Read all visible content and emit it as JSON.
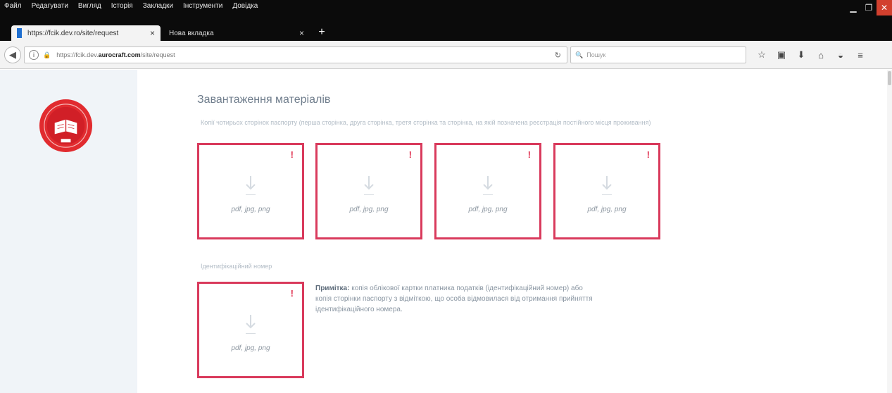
{
  "menu": [
    "Файл",
    "Редагувати",
    "Вигляд",
    "Історія",
    "Закладки",
    "Інструменти",
    "Довідка"
  ],
  "window_controls": [
    "minimize-icon",
    "restore-icon",
    "close-icon"
  ],
  "tabs": [
    {
      "label": "https://fcik.dev.ro/site/request",
      "close": "×"
    },
    {
      "label": "Нова вкладка",
      "close": "×"
    }
  ],
  "new_tab": "+",
  "address": {
    "prefix": "https://fcik.dev.",
    "domain": "aurocraft.com",
    "suffix": "/site/request"
  },
  "search": {
    "placeholder": "Пошук"
  },
  "toolbar_icons": [
    "star-icon",
    "clipboard-icon",
    "download-icon",
    "home-icon",
    "pocket-icon",
    "menu-icon"
  ],
  "page": {
    "title": "Завантаження матеріалів",
    "passport_description": "Копії чотирьох сторінок паспорту (перша сторінка, друга сторінка, третя сторінка та сторінка, на якій позначена реєстрація постійного місця проживання)",
    "id_label": "Ідентифікаційний номер",
    "upload_format": "pdf, jpg, png",
    "required_mark": "!",
    "note_label": "Примітка:",
    "note_text": "копія облікової картки платника податків (ідентифікаційний номер) або копія сторінки паспорту з відміткою, що особа відмовилася від отримання прийняття ідентифікаційного номера."
  },
  "accent_color": "#d93a5c"
}
